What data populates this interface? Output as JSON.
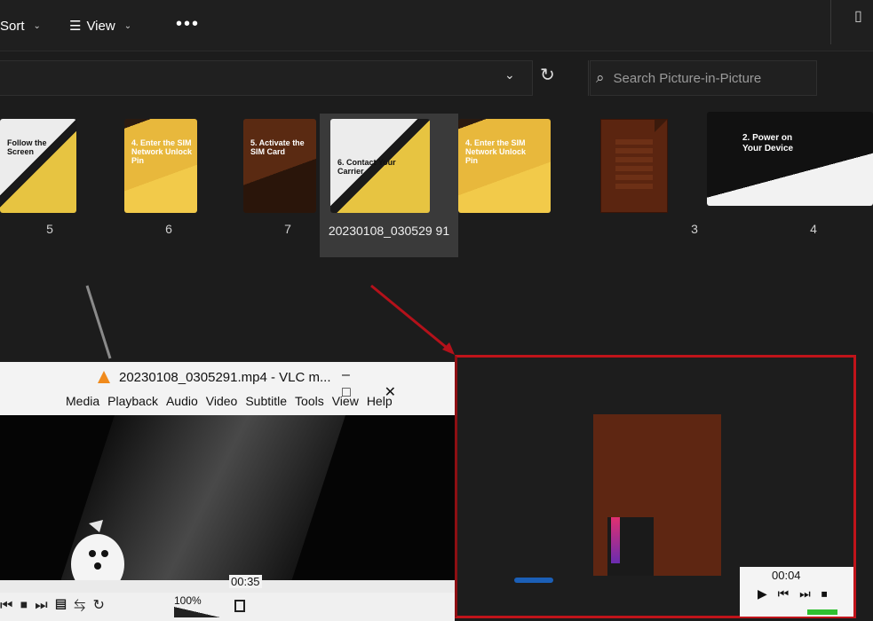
{
  "toolbar": {
    "sort_label": "Sort",
    "view_label": "View",
    "more_label": "•••",
    "details_icon": "details-pane-icon"
  },
  "address": {
    "search_placeholder": "Search Picture-in-Picture"
  },
  "thumbnails": [
    {
      "label": "5",
      "text": "Follow the Screen",
      "style": "white"
    },
    {
      "label": "6",
      "text": "4. Enter the SIM Network Unlock Pin",
      "style": "yellow"
    },
    {
      "label": "7",
      "text": "5. Activate the SIM Card",
      "style": "brown"
    },
    {
      "label": "20230108_030529 91",
      "text": "6. Contact Your Carrier",
      "style": "white"
    },
    {
      "label": "",
      "text": "4. Enter the SIM Network Unlock Pin",
      "style": "yellow"
    },
    {
      "label": "3",
      "text": "",
      "style": "doc"
    },
    {
      "label": "4",
      "text": "2. Power on Your Device",
      "style": "white"
    }
  ],
  "vlc": {
    "title": "20230108_0305291.mp4 - VLC m...",
    "menu": [
      "Media",
      "Playback",
      "Audio",
      "Video",
      "Subtitle",
      "Tools",
      "View",
      "Help"
    ],
    "time": "00:35",
    "volume": "100%"
  },
  "pip": {
    "time": "00:04"
  },
  "colors": {
    "highlight": "#c0141a",
    "vlc_accent": "#f08a1c",
    "card_yellow": "#e8b83c",
    "card_brown": "#5e2612"
  }
}
